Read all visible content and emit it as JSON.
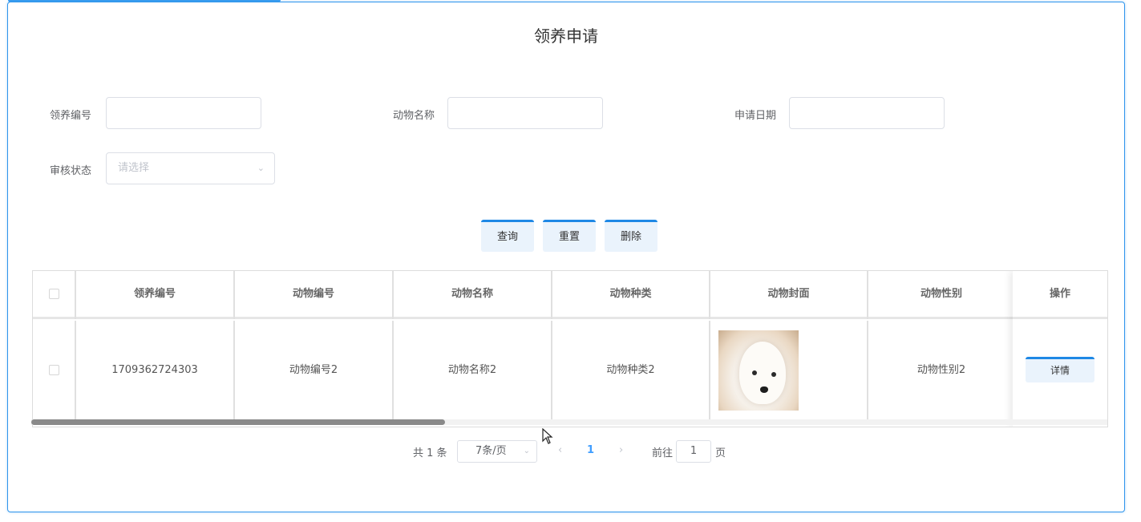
{
  "page": {
    "title": "领养申请"
  },
  "search": {
    "adopt_no_label": "领养编号",
    "animal_name_label": "动物名称",
    "apply_date_label": "申请日期",
    "review_status_label": "审核状态",
    "review_status_placeholder": "请选择"
  },
  "actions": {
    "query": "查询",
    "reset": "重置",
    "delete": "删除"
  },
  "table": {
    "columns": [
      "领养编号",
      "动物编号",
      "动物名称",
      "动物种类",
      "动物封面",
      "动物性别",
      "操作"
    ],
    "rows": [
      {
        "adopt_no": "1709362724303",
        "animal_no": "动物编号2",
        "animal_name": "动物名称2",
        "animal_type": "动物种类2",
        "cover": "dog-photo",
        "animal_gender": "动物性别2",
        "detail_label": "详情"
      }
    ]
  },
  "pagination": {
    "total": "共 1 条",
    "page_size": "7条/页",
    "current_page": "1",
    "goto_prefix": "前往",
    "goto_value": "1",
    "goto_suffix": "页"
  },
  "icons": {
    "dropdown": "chevron-down-icon",
    "prev": "chevron-left-icon",
    "next": "chevron-right-icon",
    "cursor": "mouse-pointer-icon"
  },
  "colors": {
    "accent": "#1e88e5",
    "panel_border": "#2f95ec",
    "button_bg": "#eaf3fc",
    "active_page": "#409eff"
  }
}
